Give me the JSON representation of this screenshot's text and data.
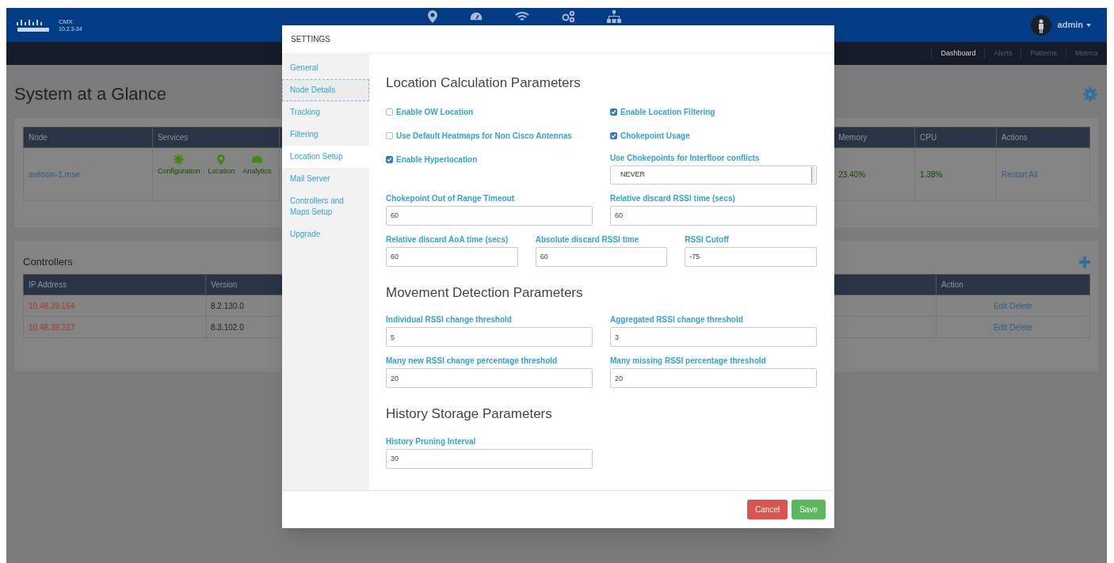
{
  "header": {
    "brand": "CMX",
    "version": "10.2.3-34",
    "user": "admin"
  },
  "subnav": [
    {
      "label": "Dashboard",
      "selected": true
    },
    {
      "label": "Alerts",
      "selected": false
    },
    {
      "label": "Patterns",
      "selected": false
    },
    {
      "label": "Metrics",
      "selected": false
    }
  ],
  "page_title": "System at a Glance",
  "nodes_table": {
    "columns": [
      "Node",
      "Services",
      "Memory",
      "CPU",
      "Actions"
    ],
    "rows": [
      {
        "node": "avitosin-1.mse",
        "services": [
          "Configuration",
          "Location",
          "Analytics"
        ],
        "memory": "23.40%",
        "cpu": "1.38%",
        "action": "Restart All"
      }
    ]
  },
  "controllers": {
    "title": "Controllers",
    "columns": [
      "IP Address",
      "Version",
      "Action"
    ],
    "rows": [
      {
        "ip": "10.48.39.164",
        "version": "8.2.130.0",
        "actions": [
          "Edit",
          "Delete"
        ]
      },
      {
        "ip": "10.48.39.227",
        "version": "8.3.102.0",
        "actions": [
          "Edit",
          "Delete"
        ]
      }
    ]
  },
  "modal": {
    "title": "SETTINGS",
    "nav": [
      {
        "label": "General",
        "selected": false,
        "focused": false
      },
      {
        "label": "Node Details",
        "selected": false,
        "focused": true
      },
      {
        "label": "Tracking",
        "selected": false,
        "focused": false
      },
      {
        "label": "Filtering",
        "selected": false,
        "focused": false
      },
      {
        "label": "Location Setup",
        "selected": true,
        "focused": false
      },
      {
        "label": "Mail Server",
        "selected": false,
        "focused": false
      },
      {
        "label": "Controllers and Maps Setup",
        "selected": false,
        "focused": false
      },
      {
        "label": "Upgrade",
        "selected": false,
        "focused": false
      }
    ],
    "sections": [
      {
        "title": "Location Calculation Parameters",
        "rows": [
          [
            {
              "kind": "checkbox",
              "label": "Enable OW Location",
              "checked": false
            },
            {
              "kind": "checkbox",
              "label": "Enable Location Filtering",
              "checked": true
            }
          ],
          [
            {
              "kind": "checkbox",
              "label": "Use Default Heatmaps for Non Cisco Antennas",
              "checked": false
            },
            {
              "kind": "checkbox",
              "label": "Chokepoint Usage",
              "checked": true
            }
          ],
          [
            {
              "kind": "checkbox",
              "label": "Enable Hyperlocation",
              "checked": true
            },
            {
              "kind": "select",
              "label": "Use Chokepoints for Interfloor conflicts",
              "value": "NEVER"
            }
          ],
          [
            {
              "kind": "input",
              "label": "Chokepoint Out of Range Timeout",
              "value": "60"
            },
            {
              "kind": "input",
              "label": "Relative discard RSSI time (secs)",
              "value": "60"
            }
          ],
          [
            {
              "kind": "input",
              "label": "Relative discard AoA time (secs)",
              "value": "60"
            },
            {
              "kind": "input",
              "label": "Absolute discard RSSI time",
              "value": "60"
            },
            {
              "kind": "input",
              "label": "RSSI Cutoff",
              "value": "-75"
            }
          ]
        ]
      },
      {
        "title": "Movement Detection Parameters",
        "rows": [
          [
            {
              "kind": "input",
              "label": "Individual RSSI change threshold",
              "value": "5"
            },
            {
              "kind": "input",
              "label": "Aggregated RSSI change threshold",
              "value": "3"
            }
          ],
          [
            {
              "kind": "input",
              "label": "Many new RSSI change percentage threshold",
              "value": "20"
            },
            {
              "kind": "input",
              "label": "Many missing RSSI percentage threshold",
              "value": "20"
            }
          ]
        ]
      },
      {
        "title": "History Storage Parameters",
        "rows": [
          [
            {
              "kind": "input",
              "label": "History Pruning Interval",
              "value": "30"
            }
          ]
        ]
      }
    ],
    "buttons": [
      {
        "kind": "cancel",
        "label": "Cancel"
      },
      {
        "kind": "save",
        "label": "Save"
      }
    ]
  }
}
